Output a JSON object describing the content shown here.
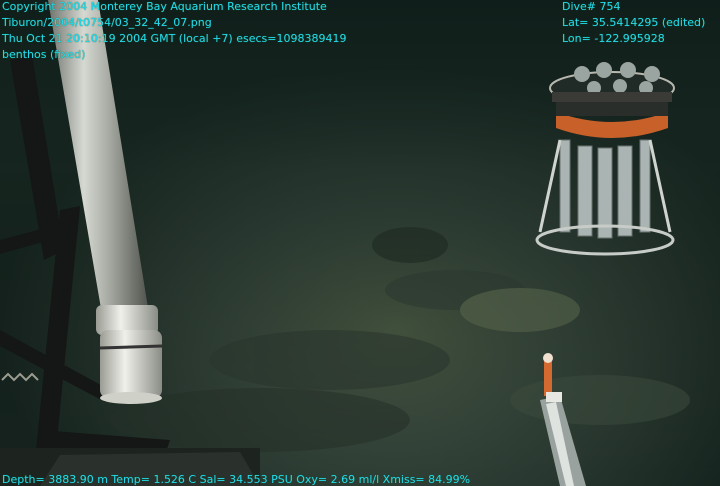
{
  "overlay": {
    "copyright": "Copyright 2004 Monterey Bay Aquarium Research Institute",
    "filename": "Tiburon/2004/t0754/03_32_42_07.png",
    "datetime": "Thu Oct 21 20:10:19 2004 GMT (local +7)  esecs=1098389419",
    "category": "benthos (fixed)",
    "dive": "Dive# 754",
    "lat": "Lat= 35.5414295 (edited)",
    "lon": "Lon= -122.995928",
    "telemetry": "Depth= 3883.90 m  Temp= 1.526 C  Sal= 34.553 PSU  Oxy= 2.69 ml/l  Xmiss= 84.99%"
  },
  "colors": {
    "overlay_text": "#27d8ec",
    "seafloor_dark": "#1a2a24",
    "seafloor_light": "#4a5a44",
    "sampler_orange": "#c8602a"
  }
}
